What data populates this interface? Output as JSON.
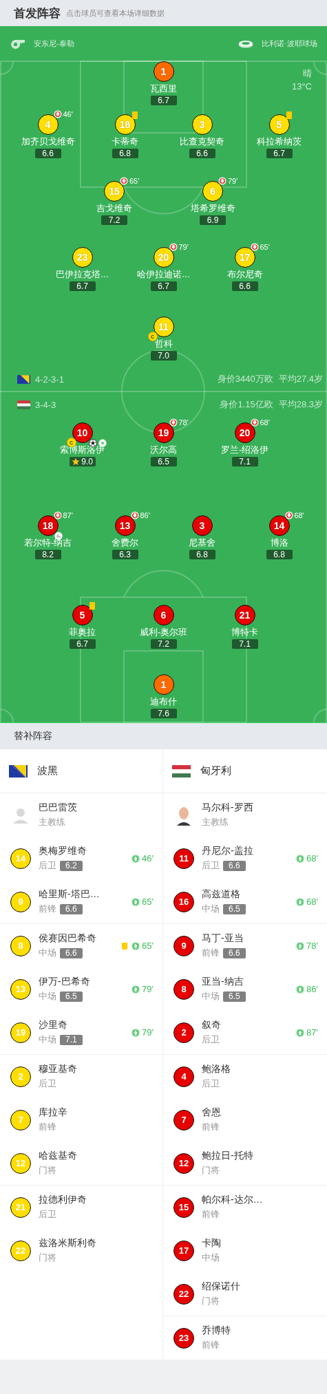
{
  "header": {
    "title": "首发阵容",
    "subtitle": "点击球员可查看本场详细数据"
  },
  "match": {
    "referee": "安东尼-泰勒",
    "stadium": "比利诺·波耶球场",
    "weather": "晴",
    "temperature": "13°C"
  },
  "teams": [
    {
      "kind": "bosnia",
      "color": "#ffde00",
      "formation": "4-2-3-1",
      "value": "身价3440万欧",
      "avg_age": "平均27.4岁",
      "lines": [
        [
          {
            "number": "1",
            "name": "瓦西里",
            "rating": "6.7",
            "kind": "goalkeeper"
          }
        ],
        [
          {
            "number": "4",
            "name": "加齐贝戈维奇",
            "rating": "6.6",
            "kind": "outfield",
            "events": [
              {
                "kind": "sub_out",
                "minute": "46'"
              }
            ]
          },
          {
            "number": "18",
            "name": "卡蒂奇",
            "rating": "6.8",
            "kind": "outfield",
            "events": [
              {
                "kind": "yellow_card"
              }
            ]
          },
          {
            "number": "3",
            "name": "比查克契奇",
            "rating": "6.6",
            "kind": "outfield"
          },
          {
            "number": "5",
            "name": "科拉希纳茨",
            "rating": "6.7",
            "kind": "outfield",
            "events": [
              {
                "kind": "yellow_card"
              }
            ]
          }
        ],
        [
          {
            "number": "15",
            "name": "吉戈维奇",
            "rating": "7.2",
            "kind": "outfield",
            "events": [
              {
                "kind": "sub_out",
                "minute": "65'"
              }
            ]
          },
          {
            "number": "6",
            "name": "塔希罗维奇",
            "rating": "6.9",
            "kind": "outfield",
            "events": [
              {
                "kind": "sub_out",
                "minute": "79'"
              }
            ]
          }
        ],
        [
          {
            "number": "23",
            "name": "巴伊拉克塔…",
            "rating": "6.7",
            "kind": "outfield"
          },
          {
            "number": "20",
            "name": "哈伊拉迪诺…",
            "rating": "6.7",
            "kind": "outfield",
            "events": [
              {
                "kind": "sub_out",
                "minute": "79'"
              }
            ]
          },
          {
            "number": "17",
            "name": "布尔尼奇",
            "rating": "6.6",
            "kind": "outfield",
            "events": [
              {
                "kind": "sub_out",
                "minute": "65'"
              }
            ]
          }
        ],
        [
          {
            "number": "11",
            "name": "哲科",
            "rating": "7.0",
            "kind": "outfield",
            "events": [
              {
                "kind": "captain",
                "label": "C"
              }
            ]
          }
        ]
      ]
    },
    {
      "kind": "hungary",
      "color": "#e60000",
      "formation": "3-4-3",
      "value": "身价1.15亿欧",
      "avg_age": "平均28.3岁",
      "lines": [
        [
          {
            "number": "10",
            "name": "索博斯洛伊",
            "rating": "9.0",
            "kind": "outfield",
            "events": [
              {
                "kind": "captain",
                "label": "C"
              },
              {
                "kind": "goal"
              },
              {
                "kind": "penalty_goal"
              },
              {
                "kind": "mvp"
              }
            ]
          },
          {
            "number": "19",
            "name": "沃尔高",
            "rating": "6.5",
            "kind": "outfield",
            "events": [
              {
                "kind": "sub_out",
                "minute": "78'"
              }
            ]
          },
          {
            "number": "20",
            "name": "罗兰-绍洛伊",
            "rating": "7.1",
            "kind": "outfield",
            "events": [
              {
                "kind": "sub_out",
                "minute": "68'"
              }
            ]
          }
        ],
        [
          {
            "number": "18",
            "name": "若尔特-纳吉",
            "rating": "8.2",
            "kind": "outfield",
            "events": [
              {
                "kind": "sub_out",
                "minute": "87'"
              },
              {
                "kind": "assist"
              }
            ]
          },
          {
            "number": "13",
            "name": "舍费尔",
            "rating": "6.3",
            "kind": "outfield",
            "events": [
              {
                "kind": "sub_out",
                "minute": "86'"
              }
            ]
          },
          {
            "number": "3",
            "name": "尼基舍",
            "rating": "6.8",
            "kind": "outfield"
          },
          {
            "number": "14",
            "name": "博洛",
            "rating": "6.8",
            "kind": "outfield",
            "events": [
              {
                "kind": "sub_out",
                "minute": "68'"
              }
            ]
          }
        ],
        [
          {
            "number": "5",
            "name": "菲奥拉",
            "rating": "6.7",
            "kind": "outfield",
            "events": [
              {
                "kind": "yellow_card"
              }
            ]
          },
          {
            "number": "6",
            "name": "威利-奥尔班",
            "rating": "7.2",
            "kind": "outfield"
          },
          {
            "number": "21",
            "name": "博特卡",
            "rating": "7.1",
            "kind": "outfield"
          }
        ],
        [
          {
            "number": "1",
            "name": "迪布什",
            "rating": "7.6",
            "kind": "goalkeeper"
          }
        ]
      ]
    }
  ],
  "substitutes": {
    "title": "替补阵容",
    "teams": [
      {
        "name": "波黑",
        "kind": "bosnia",
        "coach": {
          "name": "巴巴雷茨",
          "role": "主教练",
          "kind": "placeholder"
        },
        "players": [
          {
            "number": "14",
            "name": "奥梅罗维奇",
            "position": "后卫",
            "rating": "6.2",
            "events": [
              {
                "kind": "sub_in",
                "minute": "46'"
              }
            ]
          },
          {
            "number": "9",
            "name": "哈里斯-塔巴…",
            "position": "前锋",
            "rating": "6.6",
            "events": [
              {
                "kind": "sub_in",
                "minute": "65'"
              }
            ]
          },
          {
            "number": "8",
            "name": "侯赛因巴希奇",
            "position": "中场",
            "rating": "6.6",
            "events": [
              {
                "kind": "yellow_card"
              },
              {
                "kind": "sub_in",
                "minute": "65'"
              }
            ]
          },
          {
            "number": "13",
            "name": "伊万-巴希奇",
            "position": "中场",
            "rating": "6.5",
            "events": [
              {
                "kind": "sub_in",
                "minute": "79'"
              }
            ]
          },
          {
            "number": "19",
            "name": "沙里奇",
            "position": "中场",
            "rating": "7.1",
            "events": [
              {
                "kind": "sub_in",
                "minute": "79'"
              }
            ]
          },
          {
            "number": "2",
            "name": "穆亚基奇",
            "position": "后卫"
          },
          {
            "number": "7",
            "name": "库拉辛",
            "position": "前锋"
          },
          {
            "number": "12",
            "name": "哈兹基奇",
            "position": "门将"
          },
          {
            "number": "21",
            "name": "拉德利伊奇",
            "position": "后卫"
          },
          {
            "number": "22",
            "name": "兹洛米斯利奇",
            "position": "门将"
          }
        ]
      },
      {
        "name": "匈牙利",
        "kind": "hungary",
        "coach": {
          "name": "马尔科-罗西",
          "role": "主教练",
          "kind": "photo"
        },
        "players": [
          {
            "number": "11",
            "name": "丹尼尔-盖拉",
            "position": "后卫",
            "rating": "6.6",
            "events": [
              {
                "kind": "sub_in",
                "minute": "68'"
              }
            ]
          },
          {
            "number": "16",
            "name": "高兹道格",
            "position": "中场",
            "rating": "6.5",
            "events": [
              {
                "kind": "sub_in",
                "minute": "68'"
              }
            ]
          },
          {
            "number": "9",
            "name": "马丁-亚当",
            "position": "前锋",
            "rating": "6.6",
            "events": [
              {
                "kind": "sub_in",
                "minute": "78'"
              }
            ]
          },
          {
            "number": "8",
            "name": "亚当-纳吉",
            "position": "中场",
            "rating": "6.5",
            "events": [
              {
                "kind": "sub_in",
                "minute": "86'"
              }
            ]
          },
          {
            "number": "2",
            "name": "叙奇",
            "position": "后卫",
            "events": [
              {
                "kind": "sub_in",
                "minute": "87'"
              }
            ]
          },
          {
            "number": "4",
            "name": "鲍洛格",
            "position": "后卫"
          },
          {
            "number": "7",
            "name": "舍恩",
            "position": "前锋"
          },
          {
            "number": "12",
            "name": "鲍拉日-托特",
            "position": "门将"
          },
          {
            "number": "15",
            "name": "帕尔科-达尔…",
            "position": "前锋"
          },
          {
            "number": "17",
            "name": "卡陶",
            "position": "中场"
          },
          {
            "number": "22",
            "name": "绍保诺什",
            "position": "门将"
          },
          {
            "number": "23",
            "name": "乔博特",
            "position": "前锋"
          }
        ]
      }
    ]
  }
}
